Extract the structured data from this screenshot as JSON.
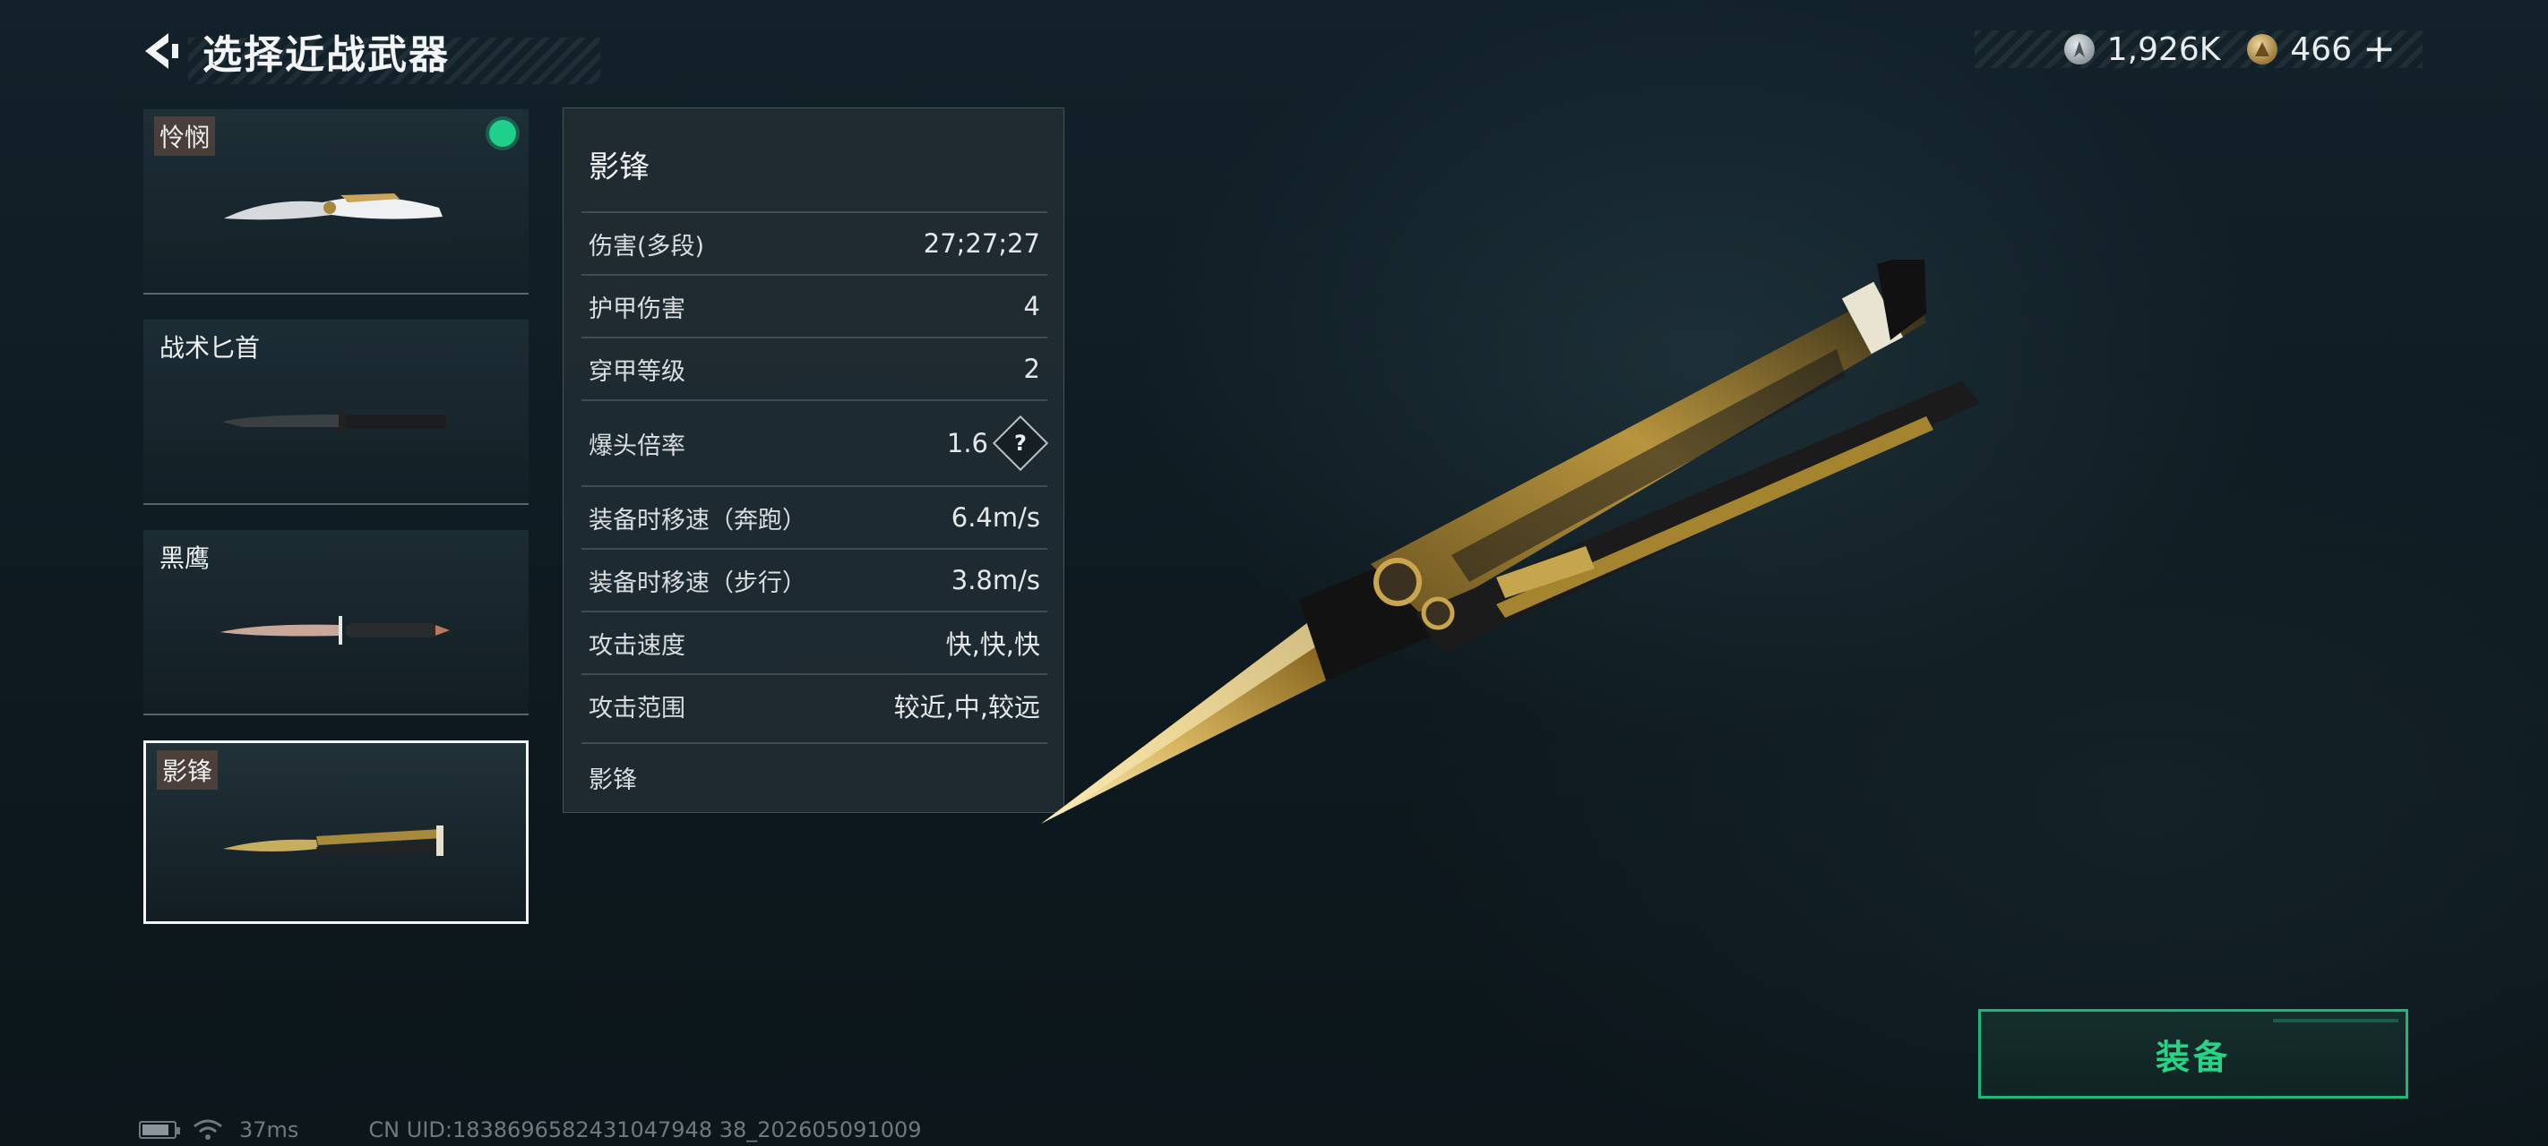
{
  "header": {
    "title": "选择近战武器",
    "back_icon": "back-arrow-icon"
  },
  "currency": {
    "silver": {
      "icon": "silver-coin-icon",
      "value": "1,926K"
    },
    "gold": {
      "icon": "gold-coin-icon",
      "value": "466",
      "plus": "+"
    }
  },
  "weapons": [
    {
      "name": "怜悯",
      "equipped": true,
      "icon": "folding-knife-icon"
    },
    {
      "name": "战术匕首",
      "equipped": false,
      "icon": "tactical-dagger-icon"
    },
    {
      "name": "黑鹰",
      "equipped": false,
      "icon": "black-hawk-knife-icon"
    },
    {
      "name": "影锋",
      "equipped": false,
      "selected": true,
      "icon": "butterfly-knife-icon"
    }
  ],
  "stats": {
    "title": "影锋",
    "rows": [
      {
        "label": "伤害(多段)",
        "value": "27;27;27"
      },
      {
        "label": "护甲伤害",
        "value": "4"
      },
      {
        "label": "穿甲等级",
        "value": "2"
      },
      {
        "label": "爆头倍率",
        "value": "1.6",
        "help": "?"
      },
      {
        "label": "装备时移速（奔跑）",
        "value": "6.4m/s"
      },
      {
        "label": "装备时移速（步行）",
        "value": "3.8m/s"
      },
      {
        "label": "攻击速度",
        "value": "快,快,快"
      },
      {
        "label": "攻击范围",
        "value": "较近,中,较远"
      }
    ],
    "description": "影锋"
  },
  "equip_button": {
    "label": "装备"
  },
  "status": {
    "ping": "37ms",
    "uid": "CN UID:1838696582431047948 38_202605091009",
    "battery_level": 0.85
  },
  "colors": {
    "accent_green": "#1fb67c",
    "equipped_dot": "#1ed08a",
    "background": "#0f1b20"
  }
}
